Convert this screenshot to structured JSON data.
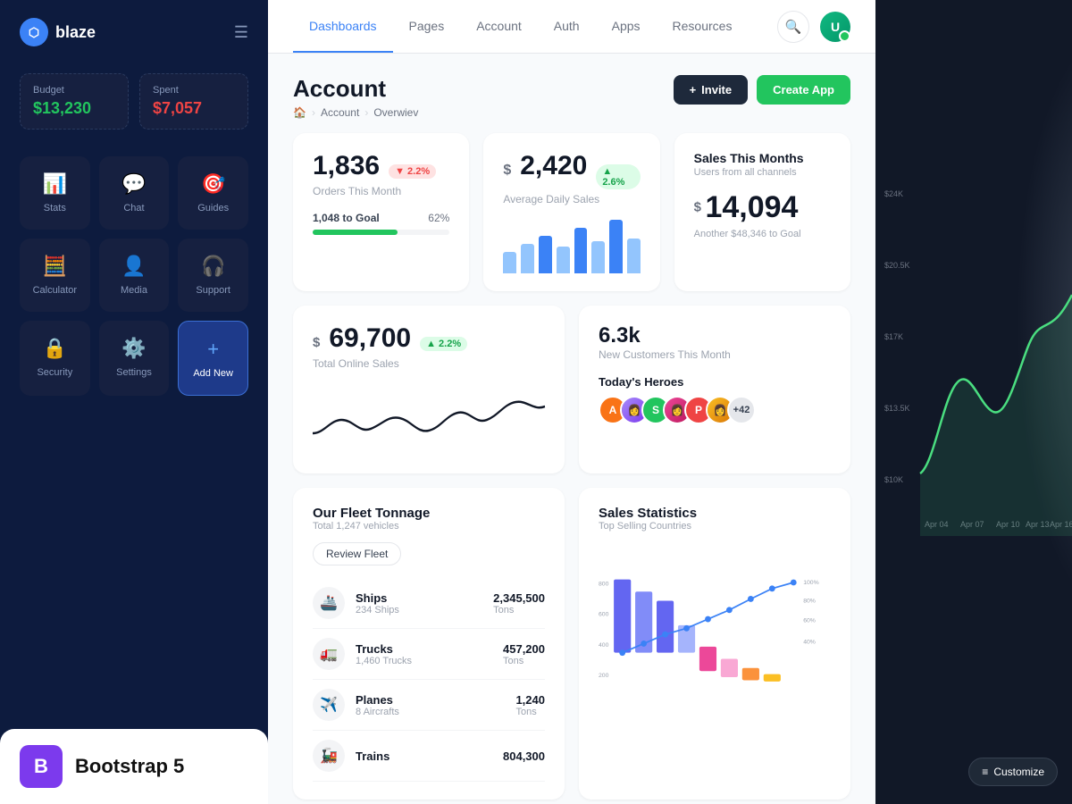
{
  "app": {
    "name": "blaze"
  },
  "sidebar": {
    "budget_label": "Budget",
    "budget_value": "$13,230",
    "spent_label": "Spent",
    "spent_value": "$7,057",
    "nav_items": [
      {
        "id": "stats",
        "label": "Stats",
        "icon": "📊"
      },
      {
        "id": "chat",
        "label": "Chat",
        "icon": "💬"
      },
      {
        "id": "guides",
        "label": "Guides",
        "icon": "🎯"
      },
      {
        "id": "calculator",
        "label": "Calculator",
        "icon": "🧮"
      },
      {
        "id": "media",
        "label": "Media",
        "icon": "👤"
      },
      {
        "id": "support",
        "label": "Support",
        "icon": "🎧"
      },
      {
        "id": "security",
        "label": "Security",
        "icon": "🔒"
      },
      {
        "id": "settings",
        "label": "Settings",
        "icon": "⚙️"
      },
      {
        "id": "add-new",
        "label": "Add New",
        "icon": "+"
      }
    ],
    "bootstrap_label": "Bootstrap 5"
  },
  "topnav": {
    "tabs": [
      {
        "id": "dashboards",
        "label": "Dashboards",
        "active": true
      },
      {
        "id": "pages",
        "label": "Pages"
      },
      {
        "id": "account",
        "label": "Account"
      },
      {
        "id": "auth",
        "label": "Auth"
      },
      {
        "id": "apps",
        "label": "Apps"
      },
      {
        "id": "resources",
        "label": "Resources"
      }
    ]
  },
  "page": {
    "title": "Account",
    "breadcrumb": [
      "🏠",
      "Account",
      "Overwiev"
    ],
    "actions": {
      "invite_label": "Invite",
      "create_label": "Create App"
    }
  },
  "stats": {
    "orders": {
      "value": "1,836",
      "label": "Orders This Month",
      "change": "▼ 2.2%",
      "change_type": "negative",
      "goal_label": "1,048 to Goal",
      "goal_pct": 62,
      "progress_pct_label": "62%"
    },
    "daily_sales": {
      "prefix": "$",
      "value": "2,420",
      "label": "Average Daily Sales",
      "change": "▲ 2.6%",
      "change_type": "positive"
    },
    "sales_month": {
      "title": "Sales This Months",
      "subtitle": "Users from all channels",
      "prefix": "$",
      "value": "14,094",
      "sub": "Another $48,346 to Goal"
    }
  },
  "online_sales": {
    "prefix": "$",
    "value": "69,700",
    "change": "▲ 2.2%",
    "label": "Total Online Sales"
  },
  "customers": {
    "value": "6.3k",
    "label": "New Customers This Month",
    "heroes_title": "Today's Heroes",
    "heroes_count": "+42"
  },
  "chart": {
    "y_labels": [
      "$24K",
      "$20.5K",
      "$17K",
      "$13.5K",
      "$10K"
    ],
    "x_labels": [
      "Apr 04",
      "Apr 07",
      "Apr 10",
      "Apr 13",
      "Apr 16"
    ]
  },
  "fleet": {
    "title": "Our Fleet Tonnage",
    "subtitle": "Total 1,247 vehicles",
    "review_btn": "Review Fleet",
    "items": [
      {
        "name": "Ships",
        "desc": "234 Ships",
        "value": "2,345,500",
        "unit": "Tons",
        "icon": "🚢"
      },
      {
        "name": "Trucks",
        "desc": "1,460 Trucks",
        "value": "457,200",
        "unit": "Tons",
        "icon": "🚛"
      },
      {
        "name": "Planes",
        "desc": "8 Aircrafts",
        "value": "1,240",
        "unit": "Tons",
        "icon": "✈️"
      },
      {
        "name": "Trains",
        "desc": "",
        "value": "804,300",
        "unit": "",
        "icon": "🚂"
      }
    ]
  },
  "sales_stats": {
    "title": "Sales Statistics",
    "subtitle": "Top Selling Countries"
  },
  "customize_btn": "Customize"
}
